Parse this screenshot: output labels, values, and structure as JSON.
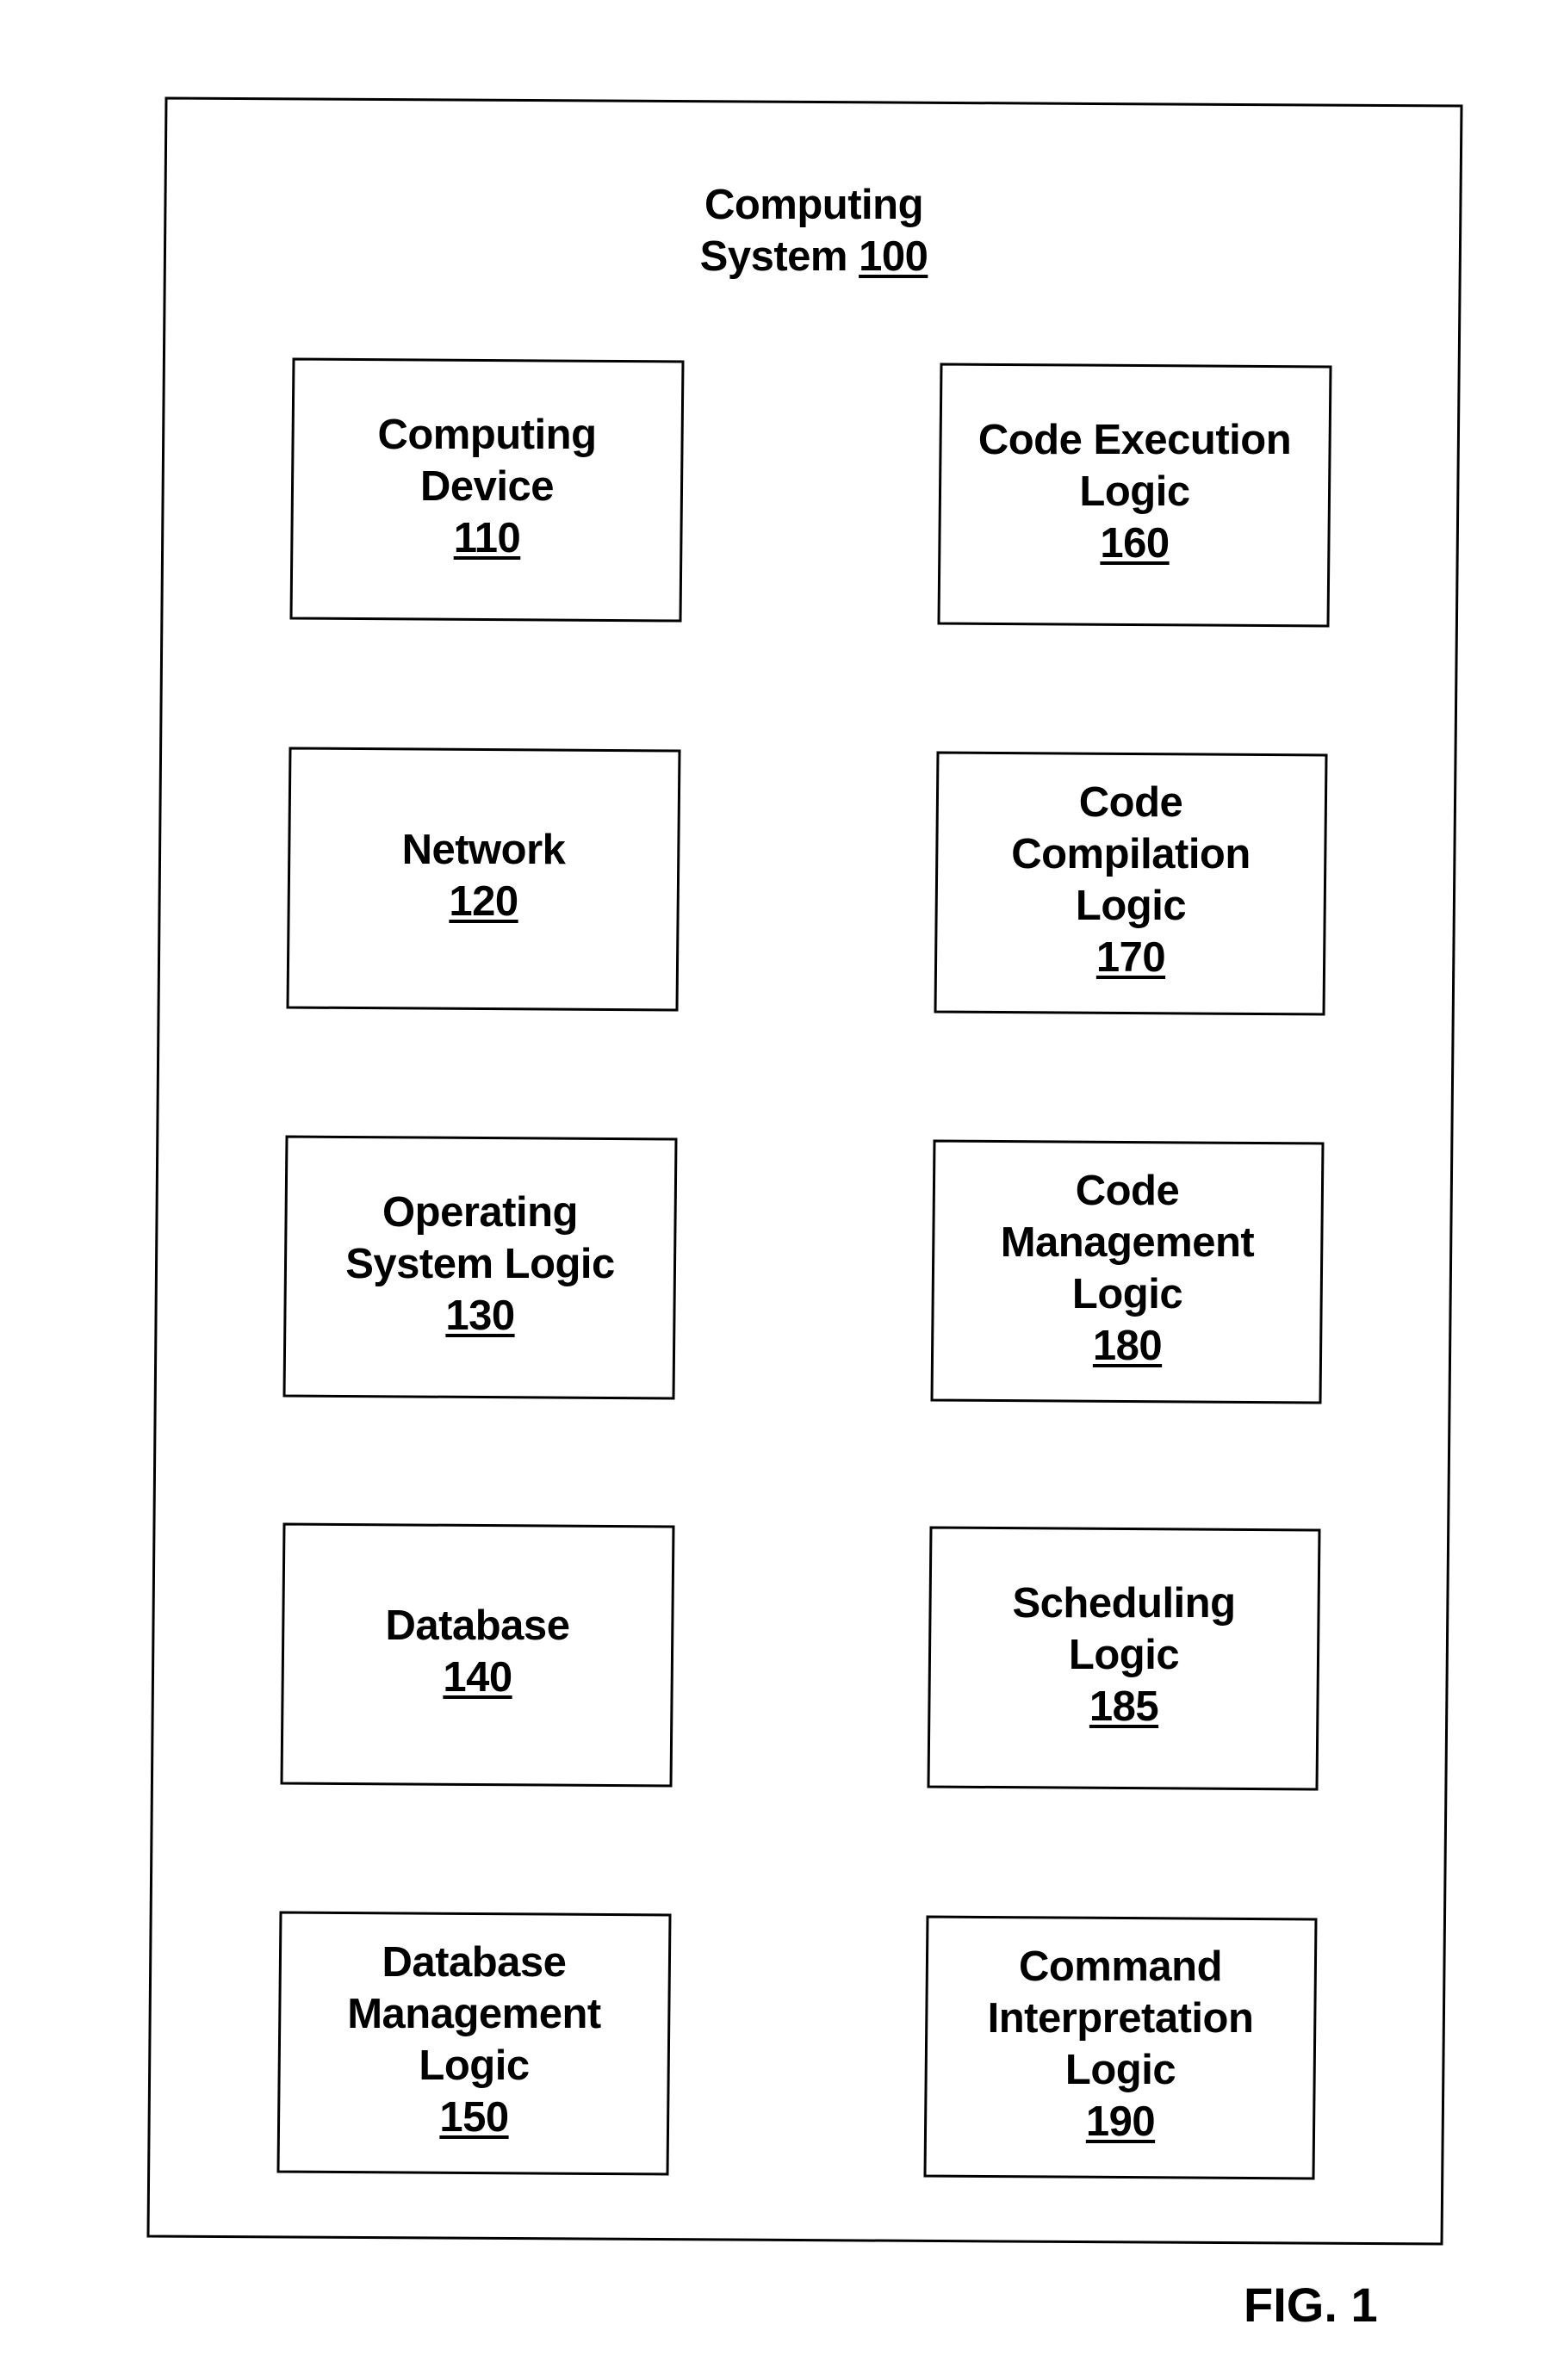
{
  "figure": {
    "label": "FIG. 1",
    "line_color": "#000000",
    "background": "#ffffff"
  },
  "system": {
    "name_line1": "Computing",
    "name_line2": "System",
    "ref": "100"
  },
  "components": [
    {
      "id": "computing-device",
      "lines": [
        "Computing",
        "Device"
      ],
      "ref": "110"
    },
    {
      "id": "network",
      "lines": [
        "Network"
      ],
      "ref": "120"
    },
    {
      "id": "operating-system-logic",
      "lines": [
        "Operating",
        "System Logic"
      ],
      "ref": "130"
    },
    {
      "id": "database",
      "lines": [
        "Database"
      ],
      "ref": "140"
    },
    {
      "id": "database-management-logic",
      "lines": [
        "Database",
        "Management",
        "Logic"
      ],
      "ref": "150"
    },
    {
      "id": "code-execution-logic",
      "lines": [
        "Code Execution",
        "Logic"
      ],
      "ref": "160"
    },
    {
      "id": "code-compilation-logic",
      "lines": [
        "Code",
        "Compilation",
        "Logic"
      ],
      "ref": "170"
    },
    {
      "id": "code-management-logic",
      "lines": [
        "Code",
        "Management",
        "Logic"
      ],
      "ref": "180"
    },
    {
      "id": "scheduling-logic",
      "lines": [
        "Scheduling",
        "Logic"
      ],
      "ref": "185"
    },
    {
      "id": "command-interpretation-logic",
      "lines": [
        "Command",
        "Interpretation",
        "Logic"
      ],
      "ref": "190"
    }
  ]
}
